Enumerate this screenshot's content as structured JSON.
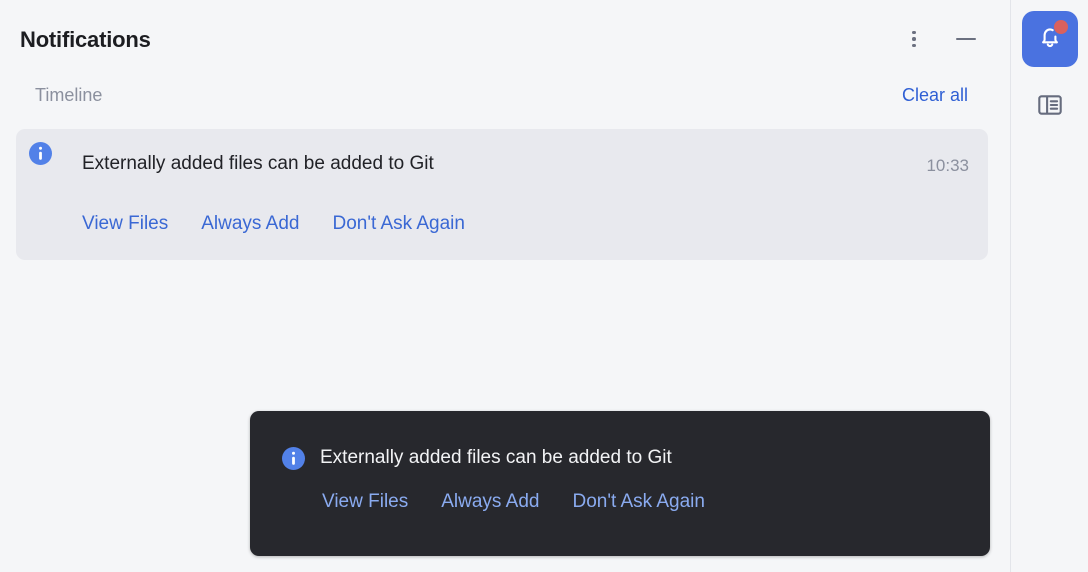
{
  "window": {
    "title": "Notifications",
    "more_icon": "more-vertical-icon",
    "minimize_icon": "minimize-icon"
  },
  "timeline": {
    "section_label": "Timeline",
    "clear_all_label": "Clear all"
  },
  "notification": {
    "icon": "info-icon",
    "title": "Externally added files can be added to Git",
    "time": "10:33",
    "actions": [
      {
        "label": "View Files"
      },
      {
        "label": "Always Add"
      },
      {
        "label": "Don't Ask Again"
      }
    ]
  },
  "toast": {
    "icon": "info-icon",
    "title": "Externally added files can be added to Git",
    "actions": [
      {
        "label": "View Files"
      },
      {
        "label": "Always Add"
      },
      {
        "label": "Don't Ask Again"
      }
    ]
  },
  "tool_sidebar": {
    "items": [
      {
        "name": "notifications",
        "icon": "bell-icon",
        "selected": true,
        "badge": true
      },
      {
        "name": "panel-view",
        "icon": "panel-layout-icon",
        "selected": false,
        "badge": false
      }
    ]
  },
  "colors": {
    "page_background": "#f5f6f8",
    "card_background": "#e8e9ee",
    "toast_background": "#27282d",
    "accent_blue": "#4a72e0",
    "link_blue": "#3a68d4",
    "toast_link_blue": "#8aabf0",
    "badge_red": "#d9615e",
    "muted_text": "#8b909e"
  }
}
